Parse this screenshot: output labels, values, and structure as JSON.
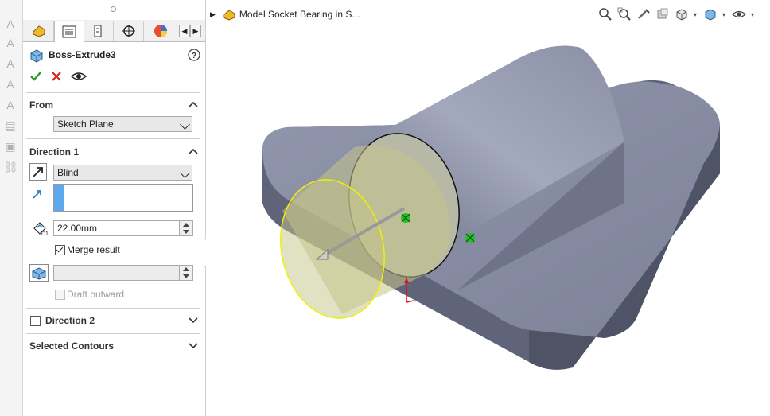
{
  "property_manager": {
    "feature_title": "Boss-Extrude3",
    "help_icon": "help-icon",
    "actions": {
      "ok": "check-icon",
      "cancel": "close-icon",
      "preview": "eye-icon"
    },
    "tabs": [
      "feature-manager-tab",
      "property-manager-tab",
      "configuration-manager-tab",
      "dimxpert-tab",
      "display-manager-tab"
    ],
    "from": {
      "header": "From",
      "start_condition": "Sketch Plane"
    },
    "direction1": {
      "header": "Direction 1",
      "end_condition": "Blind",
      "depth": "22.00mm",
      "merge_result_label": "Merge result",
      "merge_result_checked": true,
      "draft_outward_label": "Draft outward",
      "draft_outward_checked": false
    },
    "direction2": {
      "header": "Direction 2",
      "checked": false
    },
    "selected_contours": {
      "header": "Selected Contours"
    }
  },
  "viewport": {
    "document_title": "Model Socket Bearing in S..."
  },
  "colors": {
    "model_body": "#8e94ad",
    "model_dark": "#5d6275",
    "preview_fill": "#c4c48a",
    "preview_edge": "#f0f000",
    "handle_green": "#22c02a",
    "accent_blue": "#5ea8ef"
  }
}
